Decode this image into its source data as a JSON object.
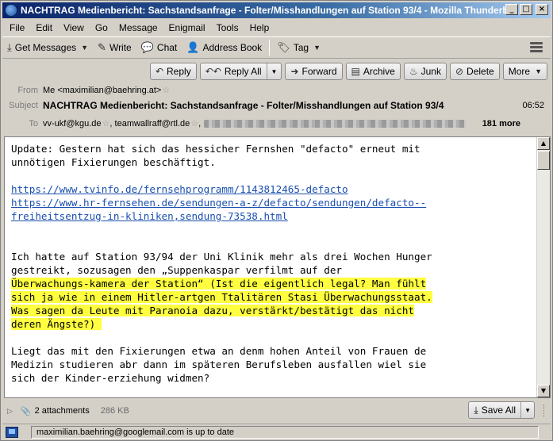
{
  "window": {
    "title": "NACHTRAG Medienbericht: Sachstandsanfrage - Folter/Misshandlungen auf Station 93/4 - Mozilla Thunderbi..."
  },
  "menu": [
    "File",
    "Edit",
    "View",
    "Go",
    "Message",
    "Enigmail",
    "Tools",
    "Help"
  ],
  "toolbar": {
    "get_messages": "Get Messages",
    "write": "Write",
    "chat": "Chat",
    "address_book": "Address Book",
    "tag": "Tag"
  },
  "actions": {
    "reply": "Reply",
    "reply_all": "Reply All",
    "forward": "Forward",
    "archive": "Archive",
    "junk": "Junk",
    "delete": "Delete",
    "more": "More"
  },
  "header": {
    "from_label": "From",
    "from_value": "Me <maximilian@baehring.at>",
    "subject_label": "Subject",
    "subject_value": "NACHTRAG Medienbericht: Sachstandsanfrage - Folter/Misshandlungen auf Station 93/4",
    "time": "06:52",
    "to_label": "To",
    "to_first": "vv-ukf@kgu.de",
    "to_second": "teamwallraff@rtl.de",
    "more_count": "181 more"
  },
  "body": {
    "p1_l1": "Update: Gestern hat sich das hessicher Fernshen \"defacto\" erneut mit",
    "p1_l2": "unnötigen Fixierungen beschäftigt.",
    "link1": "https://www.tvinfo.de/fernsehprogramm/1143812465-defacto",
    "link2_l1": "https://www.hr-fernsehen.de/sendungen-a-z/defacto/sendungen/defacto--",
    "link2_l2": "freiheitsentzug-in-kliniken,sendung-73538.html",
    "p2_l1": "Ich hatte auf Station 93/94 der Uni Klinik mehr als drei Wochen Hunger",
    "p2_l2": "gestreikt, sozusagen den „Suppenkaspar verfilmt auf der",
    "hl_l1": "Überwachungs-kamera der Station“ (Ist die eigentlich legal? Man fühlt",
    "hl_l2": "sich ja wie in einem Hitler-artgen Ttalitären Stasi Überwachungsstaat.",
    "hl_l3": "Was sagen da Leute mit Paranoia dazu, verstärkt/bestätigt das nicht",
    "hl_l4": "deren Ängste?) ",
    "p3_l1": "Liegt das mit den Fixierungen etwa an denm hohen Anteil von Frauen de",
    "p3_l2": "Medizin studieren abr dann im späteren Berufsleben ausfallen wiel sie",
    "p3_l3": "sich der Kinder-erziehung widmen?"
  },
  "attachments": {
    "count_label": "2 attachments",
    "size": "286 KB",
    "save_all": "Save All"
  },
  "status": {
    "text": "maximilian.baehring@googlemail.com is up to date"
  },
  "colors": {
    "highlight": "#ffff40",
    "link": "#1a4fb0",
    "titlebar": "#0a246a"
  }
}
